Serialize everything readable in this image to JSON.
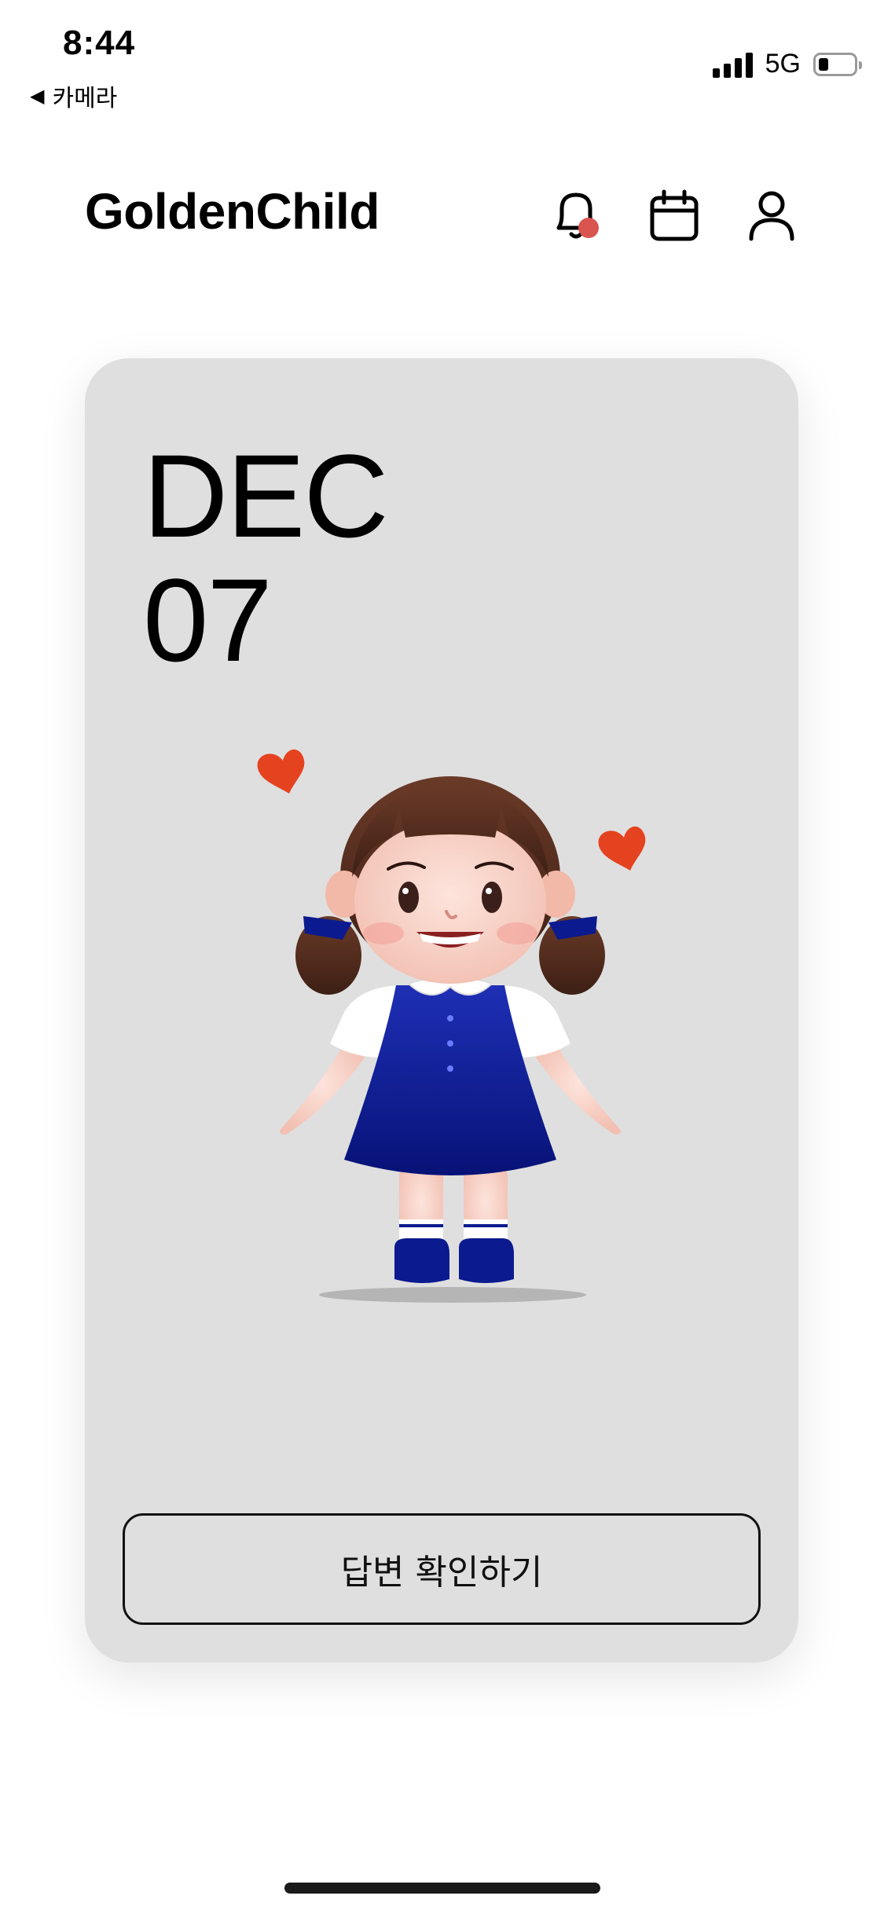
{
  "status_bar": {
    "time": "8:44",
    "back_label": "카메라",
    "network": "5G"
  },
  "header": {
    "app_title": "GoldenChild"
  },
  "card": {
    "month": "DEC",
    "day": "07",
    "button_label": "답변 확인하기"
  },
  "colors": {
    "card_background": "#dfdfdf",
    "notification_dot": "#d9534f",
    "dress": "#0b1a8f",
    "heart": "#e5431f"
  },
  "icons": [
    "bell-icon",
    "calendar-icon",
    "user-icon"
  ]
}
